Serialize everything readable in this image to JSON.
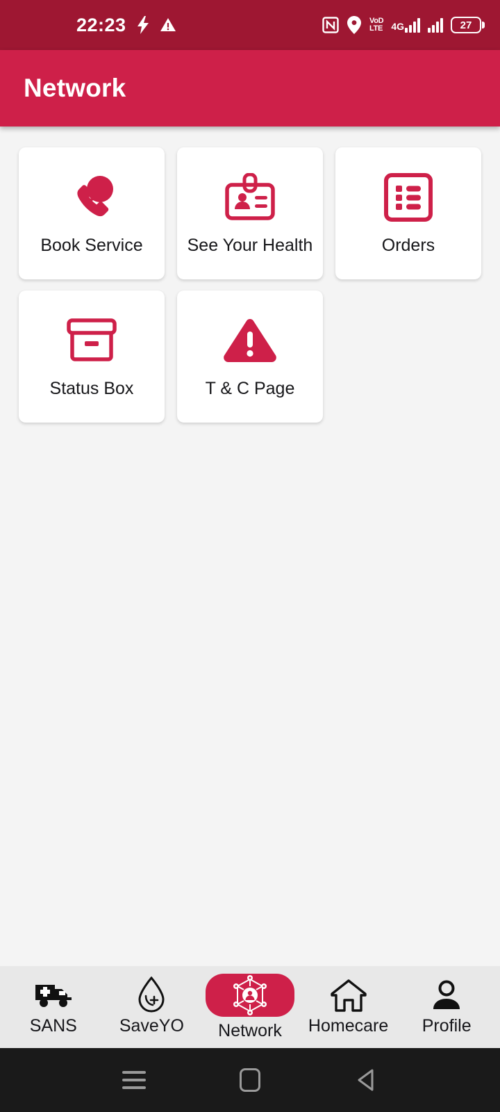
{
  "statusbar": {
    "time": "22:23",
    "icons_left": [
      "flash-icon",
      "warning-triangle-icon"
    ],
    "nfc_label": "N",
    "volte_top": "VoD",
    "volte_bottom": "LTE",
    "network_type": "4G",
    "battery_level": "27",
    "icons_right": [
      "nfc-icon",
      "location-pin-icon",
      "volte-icon",
      "signal-bars-icon",
      "signal-bars-2-icon",
      "battery-icon"
    ],
    "bg_color": "#9e1732"
  },
  "appbar": {
    "title": "Network",
    "bg_color": "#ce2049",
    "text_color": "#ffffff"
  },
  "theme": {
    "accent": "#ce2049",
    "page_bg": "#f4f4f4",
    "card_bg": "#ffffff",
    "nav_bg": "#e8e8e8",
    "label_color": "#17171a"
  },
  "grid": {
    "items": [
      {
        "label": "Book Service",
        "icon": "phone-call-icon"
      },
      {
        "label": "See Your Health",
        "icon": "id-badge-icon"
      },
      {
        "label": "Orders",
        "icon": "list-orders-icon"
      },
      {
        "label": "Status Box",
        "icon": "archive-box-icon"
      },
      {
        "label": "T & C Page",
        "icon": "warning-triangle-icon"
      }
    ]
  },
  "bottomnav": {
    "active_index": 2,
    "tabs": [
      {
        "label": "SANS",
        "icon": "ambulance-icon"
      },
      {
        "label": "SaveYO",
        "icon": "blood-drop-plus-icon"
      },
      {
        "label": "Network",
        "icon": "network-nodes-icon"
      },
      {
        "label": "Homecare",
        "icon": "home-icon"
      },
      {
        "label": "Profile",
        "icon": "person-icon"
      }
    ]
  },
  "androidnav": {
    "buttons": [
      {
        "name": "recents",
        "icon": "hamburger-icon"
      },
      {
        "name": "home",
        "icon": "home-square-icon"
      },
      {
        "name": "back",
        "icon": "back-triangle-icon"
      }
    ]
  }
}
